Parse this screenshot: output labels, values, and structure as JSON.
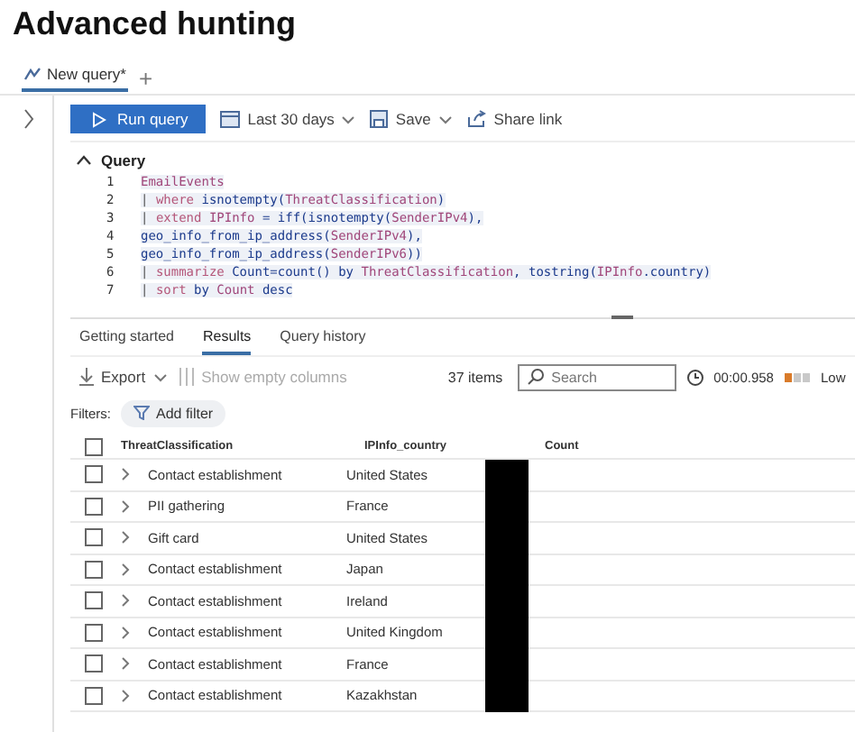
{
  "page_title": "Advanced hunting",
  "query_tabs": [
    {
      "label": "New query*",
      "selected": true
    }
  ],
  "add_tab": "+",
  "toolbar": {
    "run": "Run query",
    "time_range": "Last 30 days",
    "save": "Save",
    "share": "Share link"
  },
  "query_section": {
    "title": "Query",
    "expanded": true
  },
  "code_lines": [
    {
      "number": "1",
      "tokens": [
        {
          "kind": "table",
          "text": "EmailEvents"
        }
      ]
    },
    {
      "number": "2",
      "tokens": [
        {
          "kind": "pipe",
          "text": "| "
        },
        {
          "kind": "keyword",
          "text": "where "
        },
        {
          "kind": "func",
          "text": "isnotempty("
        },
        {
          "kind": "table",
          "text": "ThreatClassification"
        },
        {
          "kind": "func",
          "text": ")"
        }
      ]
    },
    {
      "number": "3",
      "tokens": [
        {
          "kind": "pipe",
          "text": "| "
        },
        {
          "kind": "keyword",
          "text": "extend "
        },
        {
          "kind": "table",
          "text": "IPInfo"
        },
        {
          "kind": "func",
          "text": " = iff(isnotempty("
        },
        {
          "kind": "table",
          "text": "SenderIPv4"
        },
        {
          "kind": "func",
          "text": "),"
        }
      ]
    },
    {
      "number": "4",
      "tokens": [
        {
          "kind": "func",
          "text": "geo_info_from_ip_address("
        },
        {
          "kind": "table",
          "text": "SenderIPv4"
        },
        {
          "kind": "func",
          "text": "),"
        }
      ]
    },
    {
      "number": "5",
      "tokens": [
        {
          "kind": "func",
          "text": "geo_info_from_ip_address("
        },
        {
          "kind": "table",
          "text": "SenderIPv6"
        },
        {
          "kind": "func",
          "text": "))"
        }
      ]
    },
    {
      "number": "6",
      "tokens": [
        {
          "kind": "pipe",
          "text": "| "
        },
        {
          "kind": "keyword",
          "text": "summarize "
        },
        {
          "kind": "func",
          "text": "Count=count() by "
        },
        {
          "kind": "table",
          "text": "ThreatClassification"
        },
        {
          "kind": "func",
          "text": ", tostring("
        },
        {
          "kind": "table",
          "text": "IPInfo"
        },
        {
          "kind": "func",
          "text": ".country)"
        }
      ]
    },
    {
      "number": "7",
      "tokens": [
        {
          "kind": "pipe",
          "text": "| "
        },
        {
          "kind": "keyword",
          "text": "sort "
        },
        {
          "kind": "func",
          "text": "by "
        },
        {
          "kind": "table",
          "text": "Count "
        },
        {
          "kind": "func",
          "text": "desc"
        }
      ]
    }
  ],
  "result_tabs": [
    {
      "label": "Getting started",
      "selected": false
    },
    {
      "label": "Results",
      "selected": true
    },
    {
      "label": "Query history",
      "selected": false
    }
  ],
  "results_toolbar": {
    "export": "Export",
    "show_empty": "Show empty columns",
    "item_count": "37 items",
    "search_placeholder": "Search",
    "duration": "00:00.958",
    "usage": "Low"
  },
  "filters": {
    "label": "Filters:",
    "add": "Add filter"
  },
  "table": {
    "select_all_checked": false,
    "columns": [
      "ThreatClassification",
      "IPInfo_country",
      "Count"
    ],
    "rows": [
      {
        "checked": false,
        "classification": "Contact establishment",
        "country": "United States"
      },
      {
        "checked": false,
        "classification": "PII gathering",
        "country": "France"
      },
      {
        "checked": false,
        "classification": "Gift card",
        "country": "United States"
      },
      {
        "checked": false,
        "classification": "Contact establishment",
        "country": "Japan"
      },
      {
        "checked": false,
        "classification": "Contact establishment",
        "country": "Ireland"
      },
      {
        "checked": false,
        "classification": "Contact establishment",
        "country": "United Kingdom"
      },
      {
        "checked": false,
        "classification": "Contact establishment",
        "country": "France"
      },
      {
        "checked": false,
        "classification": "Contact establishment",
        "country": "Kazakhstan"
      }
    ]
  }
}
